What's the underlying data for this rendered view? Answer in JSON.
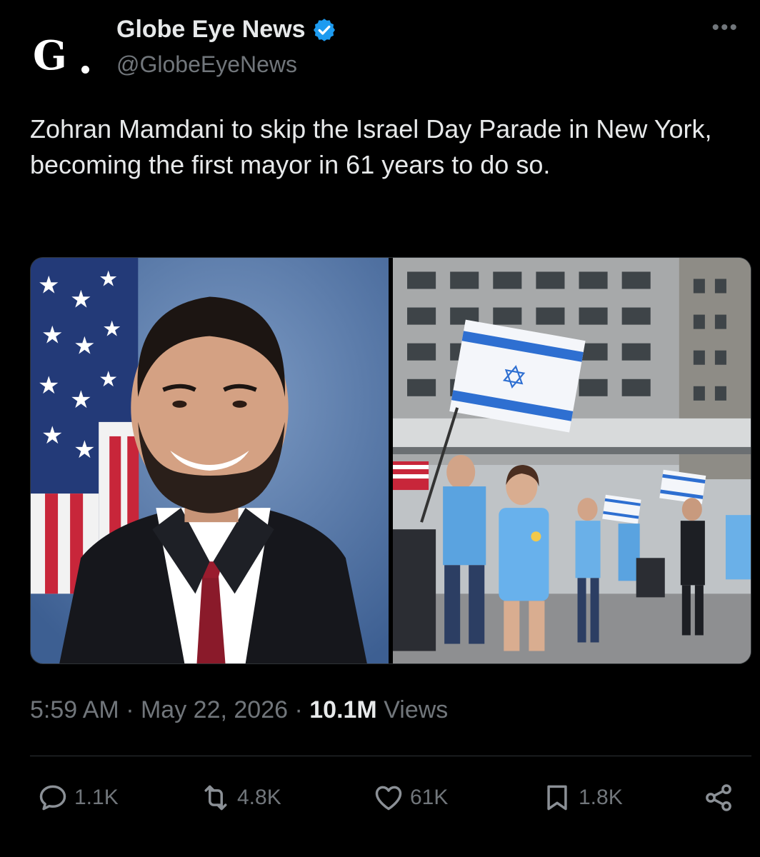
{
  "account": {
    "display_name": "Globe Eye News",
    "handle": "@GlobeEyeNews",
    "avatar_icon": "globe-eye-logo",
    "verified_icon": "verified-badge-icon",
    "verified_color": "#1d9bf0"
  },
  "menu": {
    "more_label": "•••"
  },
  "tweet": {
    "text": "Zohran Mamdani to skip the Israel Day Parade in New York, becoming the first mayor in 61 years to do so."
  },
  "meta": {
    "time": "5:59 AM",
    "date": "May 22, 2026",
    "separator": "·",
    "views_count": "10.1M",
    "views_label": "Views"
  },
  "actions": {
    "replies": "1.1K",
    "reposts": "4.8K",
    "likes": "61K",
    "bookmarks": "1.8K"
  },
  "colors": {
    "background": "#000000",
    "text": "#e7e9ea",
    "muted": "#71767b",
    "divider": "#2f3336",
    "accent": "#1d9bf0"
  }
}
